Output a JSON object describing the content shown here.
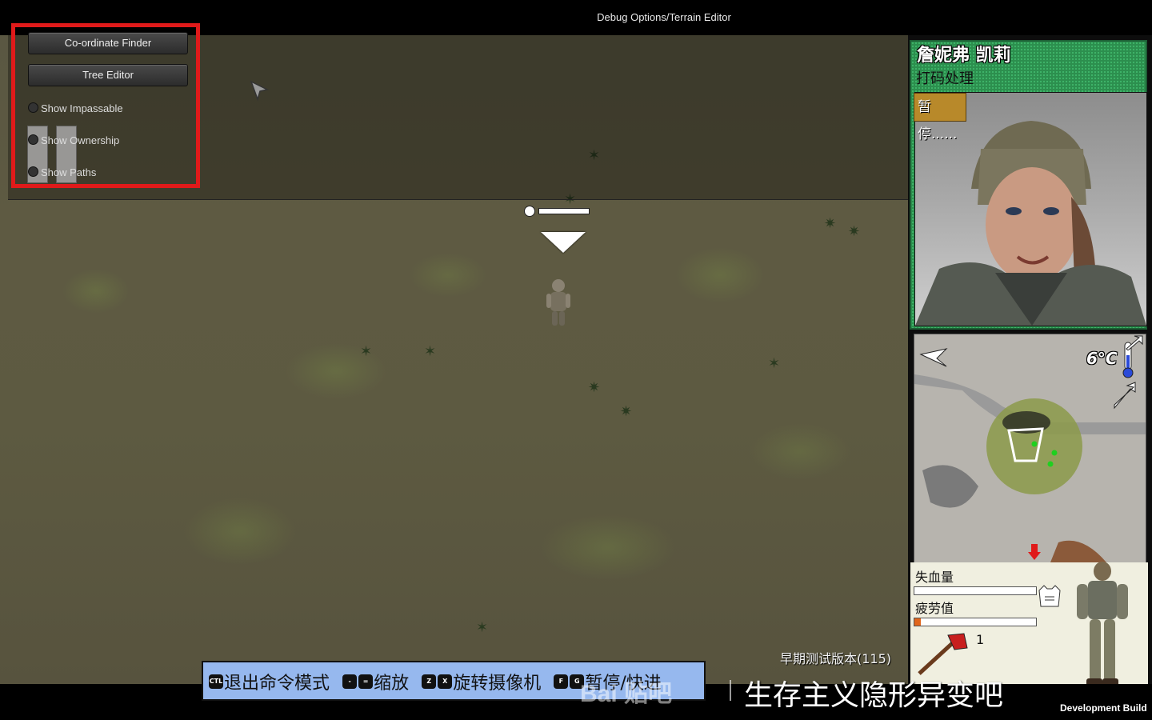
{
  "window": {
    "title": "Debug Options/Terrain Editor"
  },
  "debug_panel": {
    "buttons": [
      "Co-ordinate Finder",
      "Tree Editor"
    ],
    "toggles": [
      "Show Impassable",
      "Show Ownership",
      "Show Paths"
    ]
  },
  "character": {
    "name": "詹妮弗 凯莉",
    "status": "打码处理",
    "pause_label": "暂停......",
    "unit_health": 1.0
  },
  "minimap": {
    "temperature": "6°C"
  },
  "stats": {
    "blood_loss_label": "失血量",
    "blood_loss": 0.0,
    "fatigue_label": "疲劳值",
    "fatigue": 0.05,
    "item_count": "1"
  },
  "hints": [
    {
      "keys": [
        "CTL"
      ],
      "text": "退出命令模式"
    },
    {
      "keys": [
        "-",
        "="
      ],
      "text": "缩放"
    },
    {
      "keys": [
        "Z",
        "X"
      ],
      "text": "旋转摄像机"
    },
    {
      "keys": [
        "F",
        "G"
      ],
      "text": "暂停/快进"
    }
  ],
  "footer": {
    "version": "早期测试版本(115)",
    "watermark_logo": "Bai 贴吧",
    "watermark_text": "生存主义隐形异变吧",
    "dev_build": "Development Build"
  },
  "colors": {
    "debug_outline": "#e01a1a",
    "portrait_card": "#2c8f4e",
    "hint_bar": "#96b8ee",
    "fatigue_fill": "#e0661c"
  }
}
